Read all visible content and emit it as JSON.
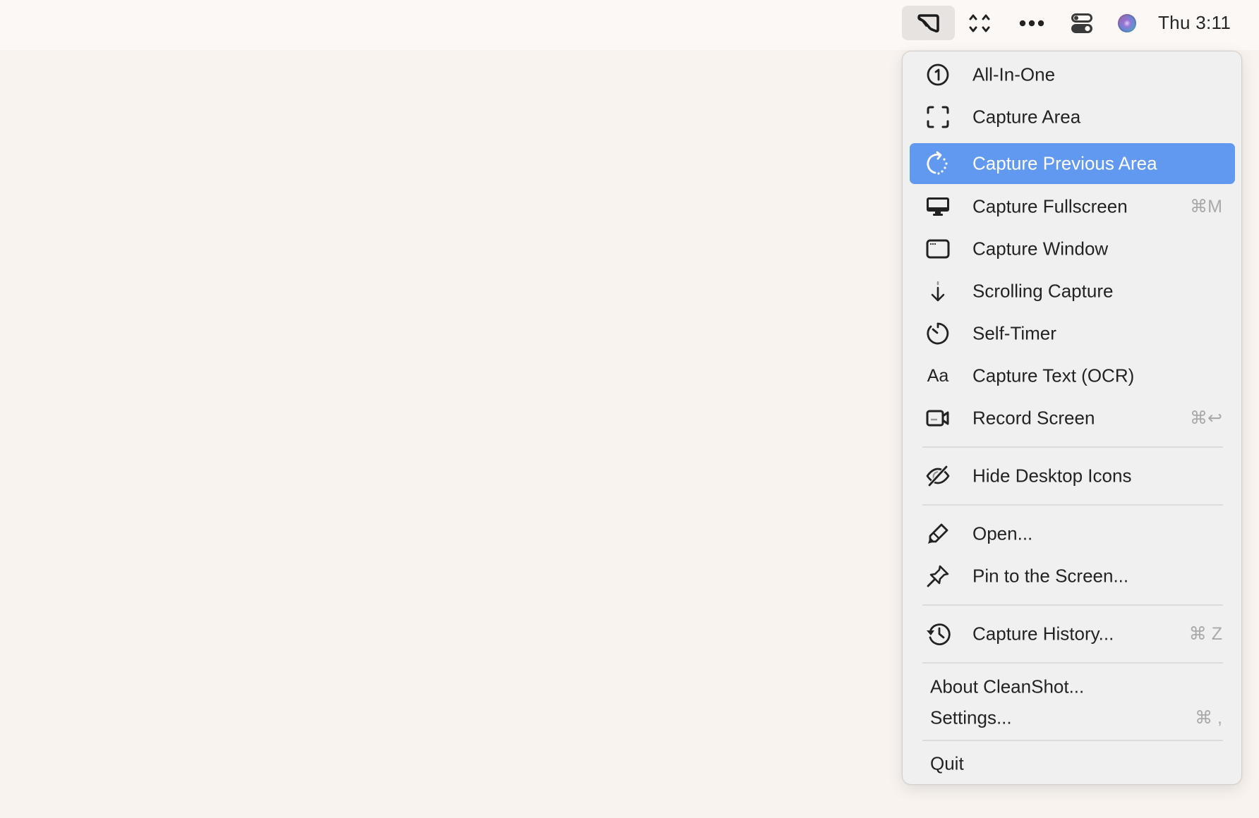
{
  "menubar": {
    "items": [
      {
        "name": "cleanshot-icon",
        "active": true
      },
      {
        "name": "crosshair-capture-icon",
        "active": false
      },
      {
        "name": "more-dots-icon",
        "active": false
      },
      {
        "name": "control-center-icon",
        "active": false
      },
      {
        "name": "siri-icon",
        "active": false
      }
    ],
    "clock": "Thu 3:11"
  },
  "menu": {
    "highlight_color": "#6199f0",
    "groups": [
      [
        {
          "label": "All-In-One",
          "icon": "all-in-one-icon",
          "shortcut": ""
        },
        {
          "label": "Capture Area",
          "icon": "capture-area-icon",
          "shortcut": ""
        },
        {
          "label": "Capture Previous Area",
          "icon": "capture-previous-area-icon",
          "shortcut": "",
          "highlighted": true
        },
        {
          "label": "Capture Fullscreen",
          "icon": "monitor-icon",
          "shortcut": "⌘M"
        },
        {
          "label": "Capture Window",
          "icon": "window-icon",
          "shortcut": ""
        },
        {
          "label": "Scrolling Capture",
          "icon": "scroll-arrow-icon",
          "shortcut": ""
        },
        {
          "label": "Self-Timer",
          "icon": "timer-icon",
          "shortcut": ""
        },
        {
          "label": "Capture Text (OCR)",
          "icon": "text-aa-icon",
          "icon_text": "Aa",
          "shortcut": ""
        },
        {
          "label": "Record Screen",
          "icon": "video-camera-icon",
          "shortcut": "⌘↩"
        }
      ],
      [
        {
          "label": "Hide Desktop Icons",
          "icon": "eye-slash-icon",
          "shortcut": ""
        }
      ],
      [
        {
          "label": "Open...",
          "icon": "pencil-icon",
          "shortcut": ""
        },
        {
          "label": "Pin to the Screen...",
          "icon": "pin-icon",
          "shortcut": ""
        }
      ],
      [
        {
          "label": "Capture History...",
          "icon": "history-icon",
          "shortcut": "⌘ Z"
        }
      ],
      [
        {
          "label": "About CleanShot...",
          "shortcut": ""
        },
        {
          "label": "Settings...",
          "shortcut": "⌘ ,"
        }
      ],
      [
        {
          "label": "Quit",
          "shortcut": ""
        }
      ]
    ]
  }
}
